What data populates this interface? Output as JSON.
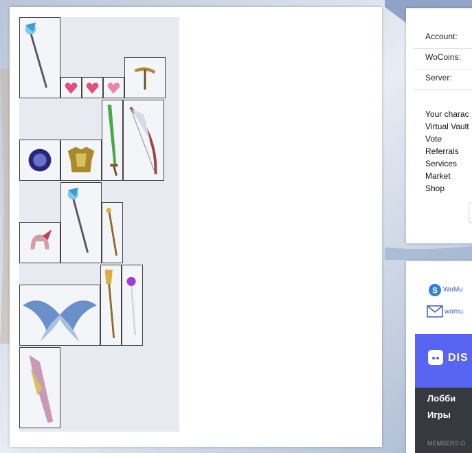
{
  "account_panel": {
    "rows": [
      {
        "label": "Account:"
      },
      {
        "label": "WoCoins:"
      },
      {
        "label": "Server:"
      }
    ],
    "menu": [
      "Your charac",
      "Virtual Vault",
      "Vote",
      "Referrals",
      "Services",
      "Market",
      "Shop"
    ]
  },
  "contacts": {
    "skype": "WoMu",
    "email": "womu."
  },
  "discord": {
    "brand": "DIS",
    "channels": [
      "Лобби",
      "Игры"
    ],
    "members_label": "MEMBERS O"
  },
  "vault_items": [
    {
      "name": "staff-item",
      "icon": "ice-staff"
    },
    {
      "name": "jewel-item-1",
      "icon": "heart-jewel"
    },
    {
      "name": "jewel-item-2",
      "icon": "heart-jewel"
    },
    {
      "name": "jewel-item-3",
      "icon": "heart-jewel"
    },
    {
      "name": "crossbow-item",
      "icon": "golden-crossbow"
    },
    {
      "name": "orb-item",
      "icon": "dark-orb"
    },
    {
      "name": "armor-item",
      "icon": "gold-armor"
    },
    {
      "name": "sword-item",
      "icon": "green-sword"
    },
    {
      "name": "bow-item",
      "icon": "winged-bow"
    },
    {
      "name": "helm-item",
      "icon": "red-helm"
    },
    {
      "name": "staff-item-2",
      "icon": "ice-staff"
    },
    {
      "name": "rod-item",
      "icon": "golden-rod"
    },
    {
      "name": "wings-item",
      "icon": "blue-wings"
    },
    {
      "name": "scepter-item",
      "icon": "golden-scepter"
    },
    {
      "name": "wand-item",
      "icon": "purple-wand"
    },
    {
      "name": "blade-item",
      "icon": "pink-blade"
    }
  ],
  "colors": {
    "link": "#3c5ab8",
    "discord_brand": "#5865f2",
    "discord_bg": "#36393f"
  }
}
